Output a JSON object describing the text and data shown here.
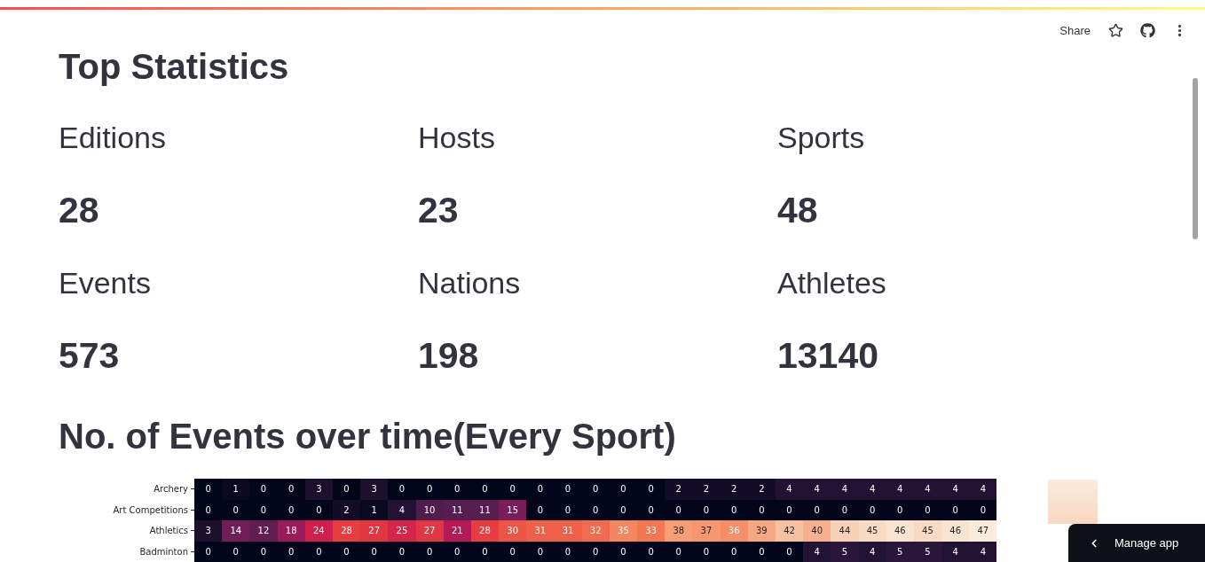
{
  "toolbar": {
    "share_label": "Share"
  },
  "title": "Top Statistics",
  "stats": [
    {
      "label": "Editions",
      "value": "28"
    },
    {
      "label": "Hosts",
      "value": "23"
    },
    {
      "label": "Sports",
      "value": "48"
    },
    {
      "label": "Events",
      "value": "573"
    },
    {
      "label": "Nations",
      "value": "198"
    },
    {
      "label": "Athletes",
      "value": "13140"
    }
  ],
  "section_title": "No. of Events over time(Every Sport)",
  "heatmap": {
    "rows": [
      {
        "label": "Archery",
        "values": [
          "0",
          "1",
          "0",
          "0",
          "3",
          "0",
          "3",
          "0",
          "0",
          "0",
          "0",
          "0",
          "0",
          "0",
          "0",
          "0",
          "0",
          "2",
          "2",
          "2",
          "2",
          "4",
          "4",
          "4",
          "4",
          "4",
          "4",
          "4",
          "4"
        ]
      },
      {
        "label": "Art Competitions",
        "values": [
          "0",
          "0",
          "0",
          "0",
          "0",
          "2",
          "1",
          "4",
          "10",
          "11",
          "11",
          "15",
          "0",
          "0",
          "0",
          "0",
          "0",
          "0",
          "0",
          "0",
          "0",
          "0",
          "0",
          "0",
          "0",
          "0",
          "0",
          "0",
          "0"
        ]
      },
      {
        "label": "Athletics",
        "values": [
          "3",
          "14",
          "12",
          "18",
          "24",
          "28",
          "27",
          "25",
          "27",
          "21",
          "28",
          "30",
          "31",
          "31",
          "32",
          "35",
          "33",
          "38",
          "37",
          "36",
          "39",
          "42",
          "40",
          "44",
          "45",
          "46",
          "45",
          "46",
          "47"
        ]
      },
      {
        "label": "Badminton",
        "values": [
          "0",
          "0",
          "0",
          "0",
          "0",
          "0",
          "0",
          "0",
          "0",
          "0",
          "0",
          "0",
          "0",
          "0",
          "0",
          "0",
          "0",
          "0",
          "0",
          "0",
          "0",
          "0",
          "4",
          "5",
          "4",
          "5",
          "5",
          "4",
          "4"
        ]
      }
    ]
  },
  "manage_app": {
    "label": "Manage app"
  }
}
